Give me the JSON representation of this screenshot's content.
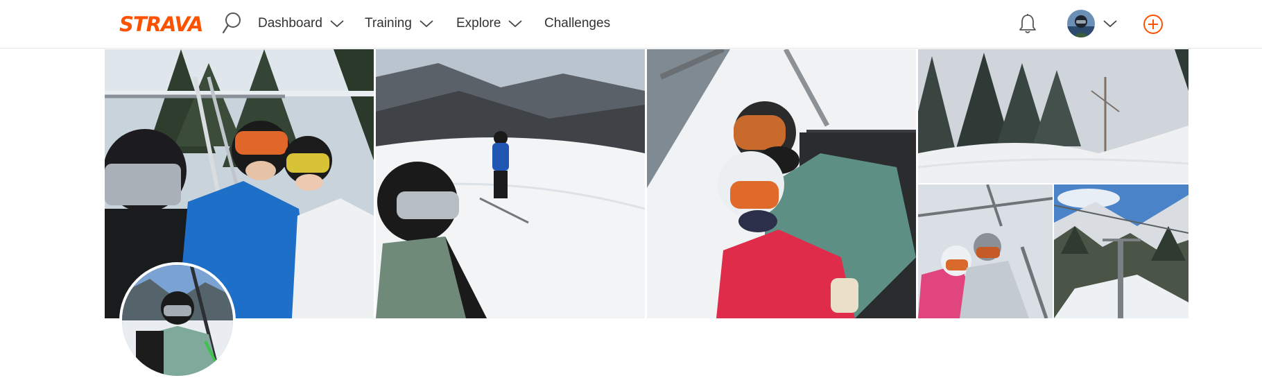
{
  "brand": {
    "logo_text": "STRAVA",
    "accent_color": "#fc5200"
  },
  "nav": {
    "items": [
      {
        "label": "Dashboard",
        "has_dropdown": true
      },
      {
        "label": "Training",
        "has_dropdown": true
      },
      {
        "label": "Explore",
        "has_dropdown": true
      },
      {
        "label": "Challenges",
        "has_dropdown": false
      }
    ]
  },
  "header_icons": {
    "search": "search-icon",
    "notifications": "bell-icon",
    "user_menu": "chevron-down-icon",
    "create": "plus-circle-icon"
  },
  "gallery": {
    "photos": [
      {
        "description": "ski-lift-group-selfie"
      },
      {
        "description": "skier-on-slope"
      },
      {
        "description": "chairlift-couple-selfie"
      },
      {
        "description": "snowy-forest-trail"
      },
      {
        "description": "couple-on-chairlift-snowfall"
      },
      {
        "description": "chairlift-tower-mountains"
      }
    ]
  }
}
